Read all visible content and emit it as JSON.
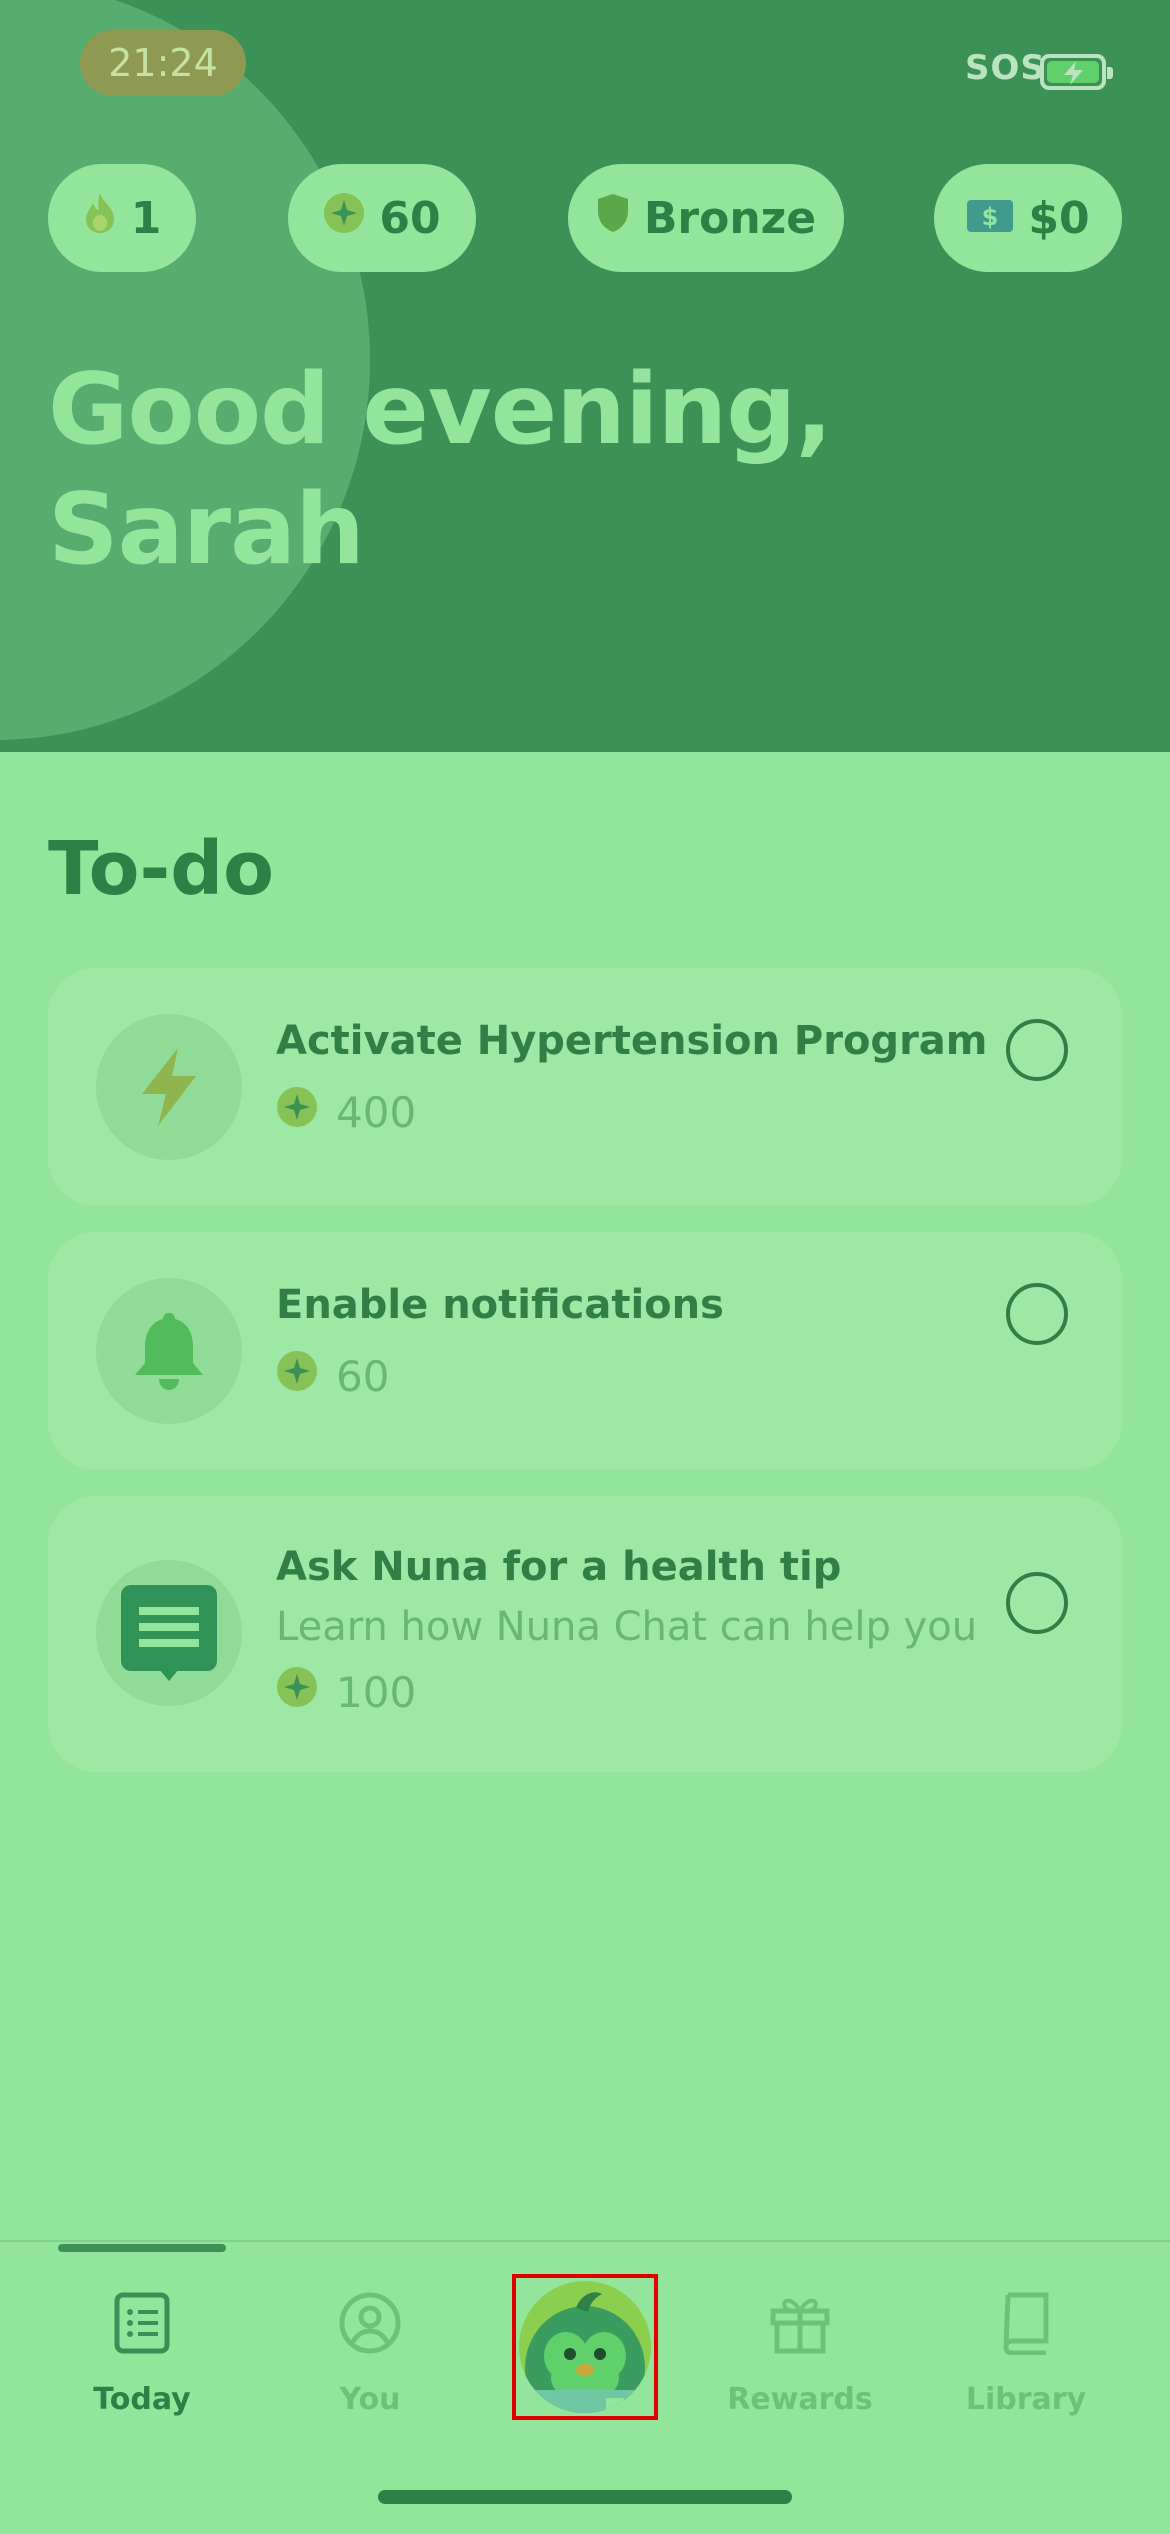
{
  "status_bar": {
    "time": "21:24",
    "sos": "SOS",
    "icons": [
      "battery-charging-icon"
    ]
  },
  "stats": {
    "streak": "1",
    "points": "60",
    "tier": "Bronze",
    "cash": "$0",
    "icons": [
      "flame-icon",
      "star-coin-icon",
      "shield-icon",
      "cash-icon"
    ]
  },
  "greeting": {
    "line1": "Good evening,",
    "line2": "Sarah"
  },
  "todo": {
    "title": "To-do",
    "items": [
      {
        "title": "Activate Hypertension Program",
        "subtitle": "",
        "reward": "400",
        "icon": "lightning-icon"
      },
      {
        "title": "Enable notifications",
        "subtitle": "",
        "reward": "60",
        "icon": "bell-icon"
      },
      {
        "title": "Ask Nuna for a health tip",
        "subtitle": "Learn how Nuna Chat can help you",
        "reward": "100",
        "icon": "chat-icon"
      }
    ]
  },
  "tabs": [
    {
      "label": "Today",
      "icon": "list-icon",
      "active": true
    },
    {
      "label": "You",
      "icon": "user-icon",
      "active": false
    },
    {
      "label": "",
      "icon": "penguin-avatar-icon",
      "active": false
    },
    {
      "label": "Rewards",
      "icon": "gift-icon",
      "active": false
    },
    {
      "label": "Library",
      "icon": "book-icon",
      "active": false
    }
  ],
  "colors": {
    "header_bg": "#3c9157",
    "page_bg": "#94e59c",
    "text_dark_green": "#2f7f47",
    "text_muted_green": "#67b875"
  }
}
